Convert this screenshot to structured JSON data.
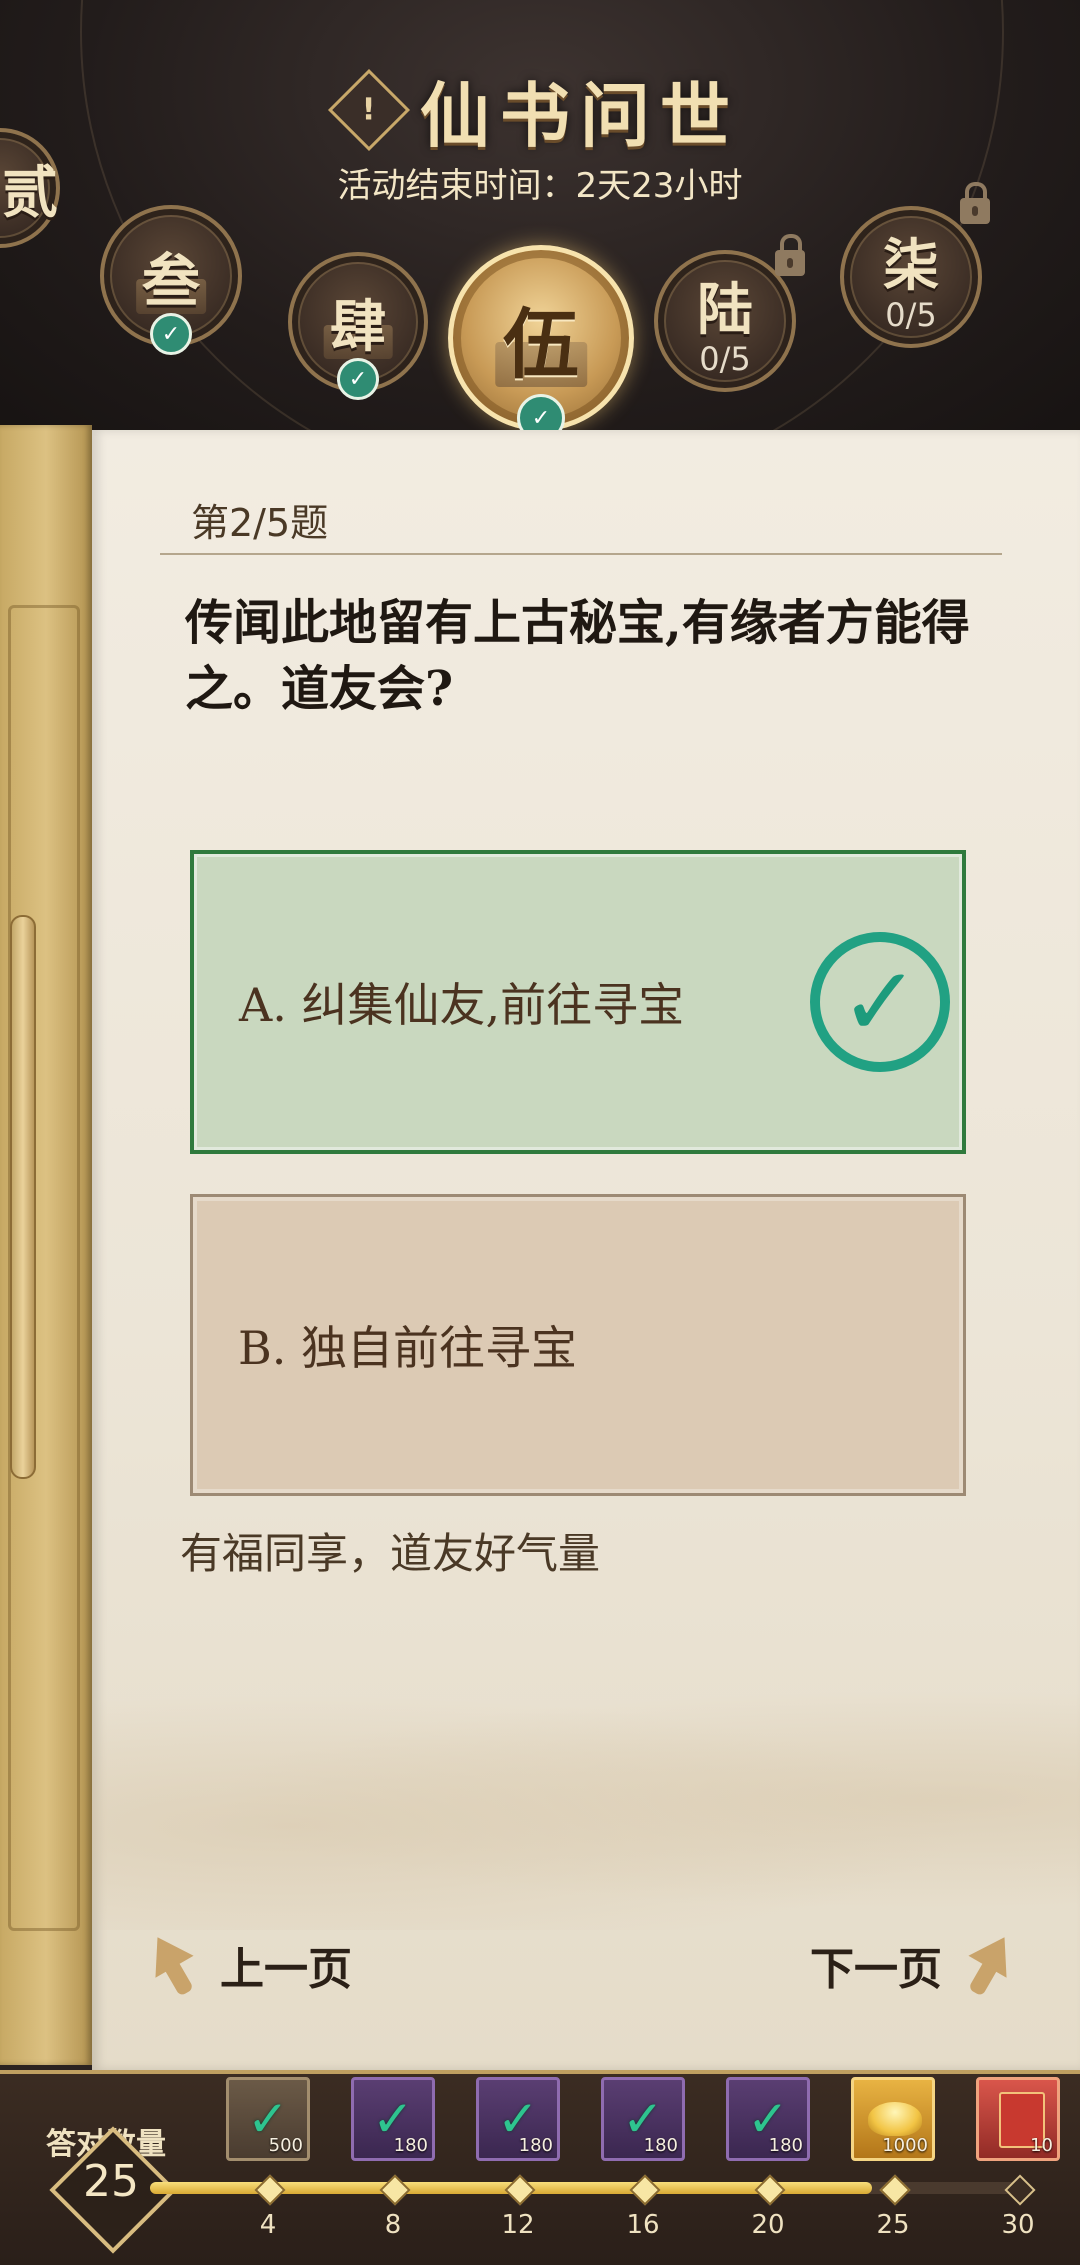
{
  "header": {
    "info_icon": "!",
    "title": "仙书问世",
    "end_time": "活动结束时间：2天23小时",
    "chapters": [
      {
        "char": "贰",
        "state": "done"
      },
      {
        "char": "叁",
        "state": "done"
      },
      {
        "char": "肆",
        "state": "done"
      },
      {
        "char": "伍",
        "state": "active_done"
      },
      {
        "char": "陆",
        "state": "locked",
        "progress": "0/5"
      },
      {
        "char": "柒",
        "state": "locked",
        "progress": "0/5"
      }
    ],
    "check_glyph": "✓"
  },
  "quiz": {
    "number": "第2/5题",
    "question": "传闻此地留有上古秘宝,有缘者方能得之。道友会?",
    "options": [
      {
        "label": "A. 纠集仙友,前往寻宝",
        "status": "correct"
      },
      {
        "label": "B. 独自前往寻宝",
        "status": "normal"
      }
    ],
    "correct_mark": "✓",
    "feedback": "有福同享，道友好气量"
  },
  "nav": {
    "prev_label": "上一页",
    "next_label": "下一页"
  },
  "rewards": {
    "count_label": "答对数量",
    "count_value": "25",
    "progress_fraction": 0.82,
    "milestones": [
      "4",
      "8",
      "12",
      "16",
      "20",
      "25",
      "30"
    ],
    "milestones_reached": [
      true,
      true,
      true,
      true,
      true,
      true,
      false
    ],
    "items": [
      {
        "type": "brown",
        "qty": "500",
        "claimed": true
      },
      {
        "type": "purple",
        "qty": "180",
        "claimed": true
      },
      {
        "type": "purple",
        "qty": "180",
        "claimed": true
      },
      {
        "type": "purple",
        "qty": "180",
        "claimed": true
      },
      {
        "type": "purple",
        "qty": "180",
        "claimed": true
      },
      {
        "type": "gold",
        "qty": "1000",
        "claimed": false
      },
      {
        "type": "red",
        "qty": "10",
        "claimed": false
      }
    ],
    "check_glyph": "✓"
  },
  "colors": {
    "correct_green": "#2f7a3d",
    "mark_teal": "#21a183",
    "gold_accent": "#d8bc80"
  }
}
